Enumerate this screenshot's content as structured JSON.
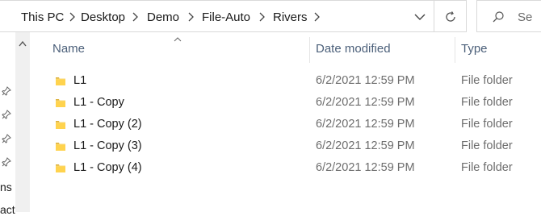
{
  "breadcrumb": {
    "items": [
      "This PC",
      "Desktop",
      "Demo",
      "File-Auto",
      "Rivers"
    ]
  },
  "search": {
    "placeholder": "Se"
  },
  "nav_pane": {
    "partial_items": [
      "ns",
      "act"
    ]
  },
  "columns": {
    "name": "Name",
    "date_modified": "Date modified",
    "type": "Type"
  },
  "files": [
    {
      "name": "L1",
      "date": "6/2/2021 12:59 PM",
      "type": "File folder"
    },
    {
      "name": "L1 - Copy",
      "date": "6/2/2021 12:59 PM",
      "type": "File folder"
    },
    {
      "name": "L1 - Copy (2)",
      "date": "6/2/2021 12:59 PM",
      "type": "File folder"
    },
    {
      "name": "L1 - Copy (3)",
      "date": "6/2/2021 12:59 PM",
      "type": "File folder"
    },
    {
      "name": "L1 - Copy (4)",
      "date": "6/2/2021 12:59 PM",
      "type": "File folder"
    }
  ],
  "icons": {
    "folder": "folder-icon",
    "pin": "pin-icon",
    "refresh": "refresh-icon",
    "search": "search-icon",
    "chevron": "chevron-right-icon"
  },
  "colors": {
    "folder": "#f8d775",
    "header_text": "#4c607a"
  }
}
